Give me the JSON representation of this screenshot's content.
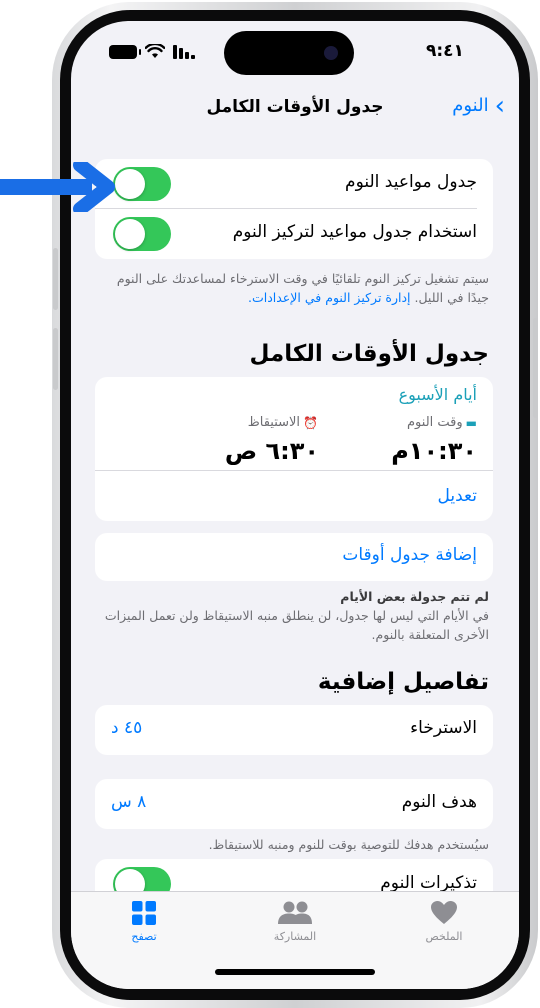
{
  "status_bar": {
    "time": "٩:٤١"
  },
  "nav": {
    "back_label": "النوم",
    "title": "جدول الأوقات الكامل"
  },
  "toggles": {
    "sleep_schedule": {
      "label": "جدول مواعيد النوم",
      "on": true
    },
    "use_for_focus": {
      "label": "استخدام جدول مواعيد لتركيز النوم",
      "on": true
    }
  },
  "focus_note": {
    "text": "سيتم تشغيل تركيز النوم تلقائيًا في وقت الاسترخاء لمساعدتك على النوم جيدًا في الليل.",
    "link": "إدارة تركيز النوم في الإعدادات."
  },
  "full_schedule": {
    "title": "جدول الأوقات الكامل",
    "week_label": "أيام الأسبوع",
    "bedtime_label": "وقت النوم",
    "bedtime": "١٠:٣٠م",
    "wake_label": "الاستيقاظ",
    "wake": "٦:٣٠ ص",
    "edit": "تعديل",
    "add_schedule": "إضافة جدول أوقات"
  },
  "unscheduled_note": {
    "title": "لم تتم جدولة بعض الأيام",
    "text": "في الأيام التي ليس لها جدول، لن ينطلق منبه الاستيقاظ ولن تعمل الميزات الأخرى المتعلقة بالنوم."
  },
  "additional": {
    "title": "تفاصيل إضافية",
    "wind_down_label": "الاسترخاء",
    "wind_down_value": "٤٥ د",
    "sleep_goal_label": "هدف النوم",
    "sleep_goal_value": "٨ س",
    "goal_note": "سيُستخدم هدفك للتوصية بوقت للنوم ومنبه للاستيقاظ.",
    "reminders_label": "تذكيرات النوم",
    "reminders_on": true
  },
  "tabbar": {
    "summary": "الملخص",
    "sharing": "المشاركة",
    "browse": "تصفح"
  },
  "colors": {
    "accent": "#007aff",
    "toggle_on": "#34c759",
    "teal": "#1ba0b8",
    "arrow": "#1a6ee6"
  }
}
